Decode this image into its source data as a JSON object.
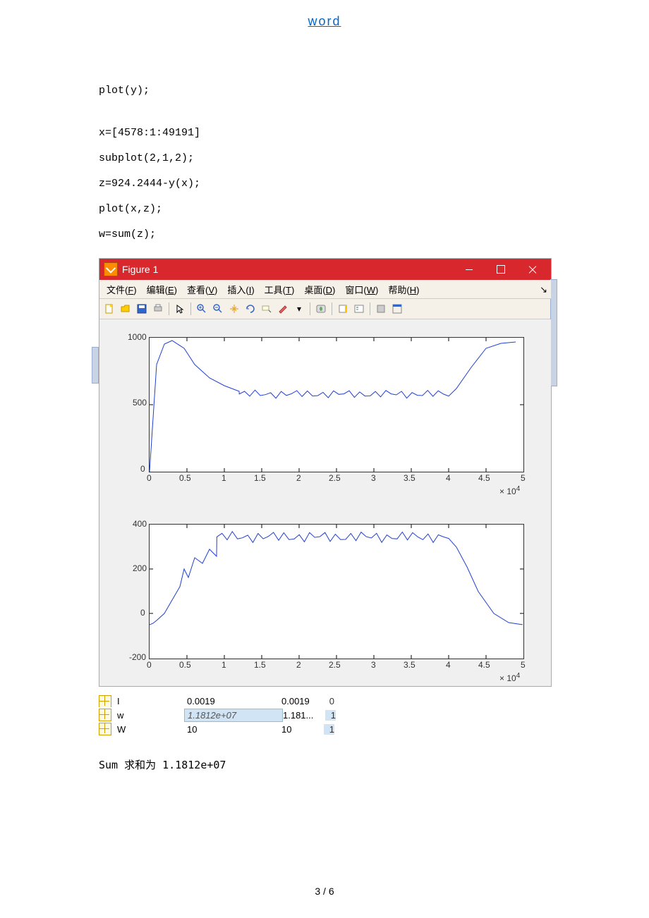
{
  "header": {
    "link_text": "word"
  },
  "code": {
    "line1": "plot(y);",
    "line2": "x=[4578:1:49191]",
    "line3": "subplot(2,1,2);",
    "line4": "z=924.2444-y(x);",
    "line5": "plot(x,z);",
    "line6": "w=sum(z);"
  },
  "figure": {
    "title": "Figure 1",
    "menus": {
      "file": "文件(F)",
      "edit": "编辑(E)",
      "view": "查看(V)",
      "insert": "插入(I)",
      "tools": "工具(T)",
      "desktop": "桌面(D)",
      "window": "窗口(W)",
      "help": "帮助(H)"
    }
  },
  "chart_data": [
    {
      "type": "line",
      "title": "",
      "xlabel": "",
      "ylabel": "",
      "xlim": [
        0,
        5
      ],
      "ylim": [
        0,
        1000
      ],
      "xticks": [
        0,
        0.5,
        1,
        1.5,
        2,
        2.5,
        3,
        3.5,
        4,
        4.5,
        5
      ],
      "yticks": [
        0,
        500,
        1000
      ],
      "x_multiplier": "× 10⁴",
      "x": [
        0,
        0.05,
        0.1,
        0.2,
        0.3,
        0.46,
        0.6,
        0.8,
        1,
        1.2,
        1.4,
        1.6,
        1.8,
        2,
        2.2,
        2.4,
        2.6,
        2.8,
        3,
        3.2,
        3.4,
        3.6,
        3.8,
        4,
        4.1,
        4.3,
        4.5,
        4.7,
        4.9
      ],
      "values": [
        0,
        400,
        800,
        950,
        980,
        920,
        800,
        700,
        640,
        600,
        580,
        590,
        570,
        590,
        570,
        585,
        575,
        585,
        575,
        585,
        575,
        585,
        575,
        580,
        620,
        780,
        920,
        960,
        970
      ]
    },
    {
      "type": "line",
      "title": "",
      "xlabel": "",
      "ylabel": "",
      "xlim": [
        0,
        5
      ],
      "ylim": [
        -200,
        400
      ],
      "xticks": [
        0,
        0.5,
        1,
        1.5,
        2,
        2.5,
        3,
        3.5,
        4,
        4.5,
        5
      ],
      "yticks": [
        -200,
        0,
        200,
        400
      ],
      "x_multiplier": "× 10⁴",
      "x": [
        0,
        0.05,
        0.1,
        0.2,
        0.4,
        0.46,
        0.6,
        0.8,
        1,
        1.2,
        1.4,
        1.6,
        1.8,
        2,
        2.2,
        2.4,
        2.6,
        2.8,
        3,
        3.2,
        3.4,
        3.6,
        3.8,
        4,
        4.1,
        4.3,
        4.5,
        4.7,
        4.9
      ],
      "values": [
        -50,
        -40,
        -30,
        0,
        120,
        200,
        280,
        320,
        350,
        350,
        345,
        350,
        340,
        350,
        340,
        350,
        345,
        350,
        340,
        355,
        340,
        350,
        345,
        340,
        300,
        140,
        0,
        -40,
        -50
      ]
    }
  ],
  "workspace": {
    "rows": [
      {
        "name": "I",
        "val": "0.0019",
        "col3": "0.0019",
        "col4": "0"
      },
      {
        "name": "w",
        "val": "1.1812e+07",
        "col3": "1.181...",
        "col4": "1",
        "highlight": true
      },
      {
        "name": "W",
        "val": "10",
        "col3": "10",
        "col4": "1"
      }
    ]
  },
  "result": {
    "text": "Sum 求和为 1.1812e+07"
  },
  "footer": {
    "page": "3 / 6"
  }
}
